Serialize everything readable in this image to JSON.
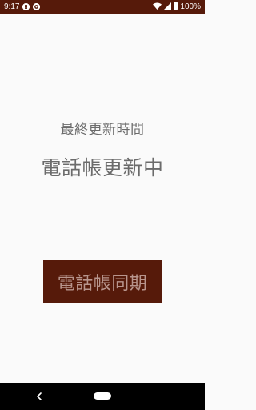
{
  "status_bar": {
    "time": "9:17",
    "battery_percent": "100%",
    "background_color": "#561a0a",
    "icons": [
      "b-badge-icon",
      "settings-badge-icon",
      "wifi-icon",
      "cell-signal-icon",
      "battery-icon"
    ]
  },
  "main": {
    "last_updated_label": "最終更新時間",
    "status_text": "電話帳更新中",
    "sync_button_label": "電話帳同期",
    "accent_color": "#561a0a",
    "text_color": "#6b6b6b"
  },
  "nav_bar": {
    "icons": [
      "back-icon",
      "home-pill-icon"
    ]
  }
}
